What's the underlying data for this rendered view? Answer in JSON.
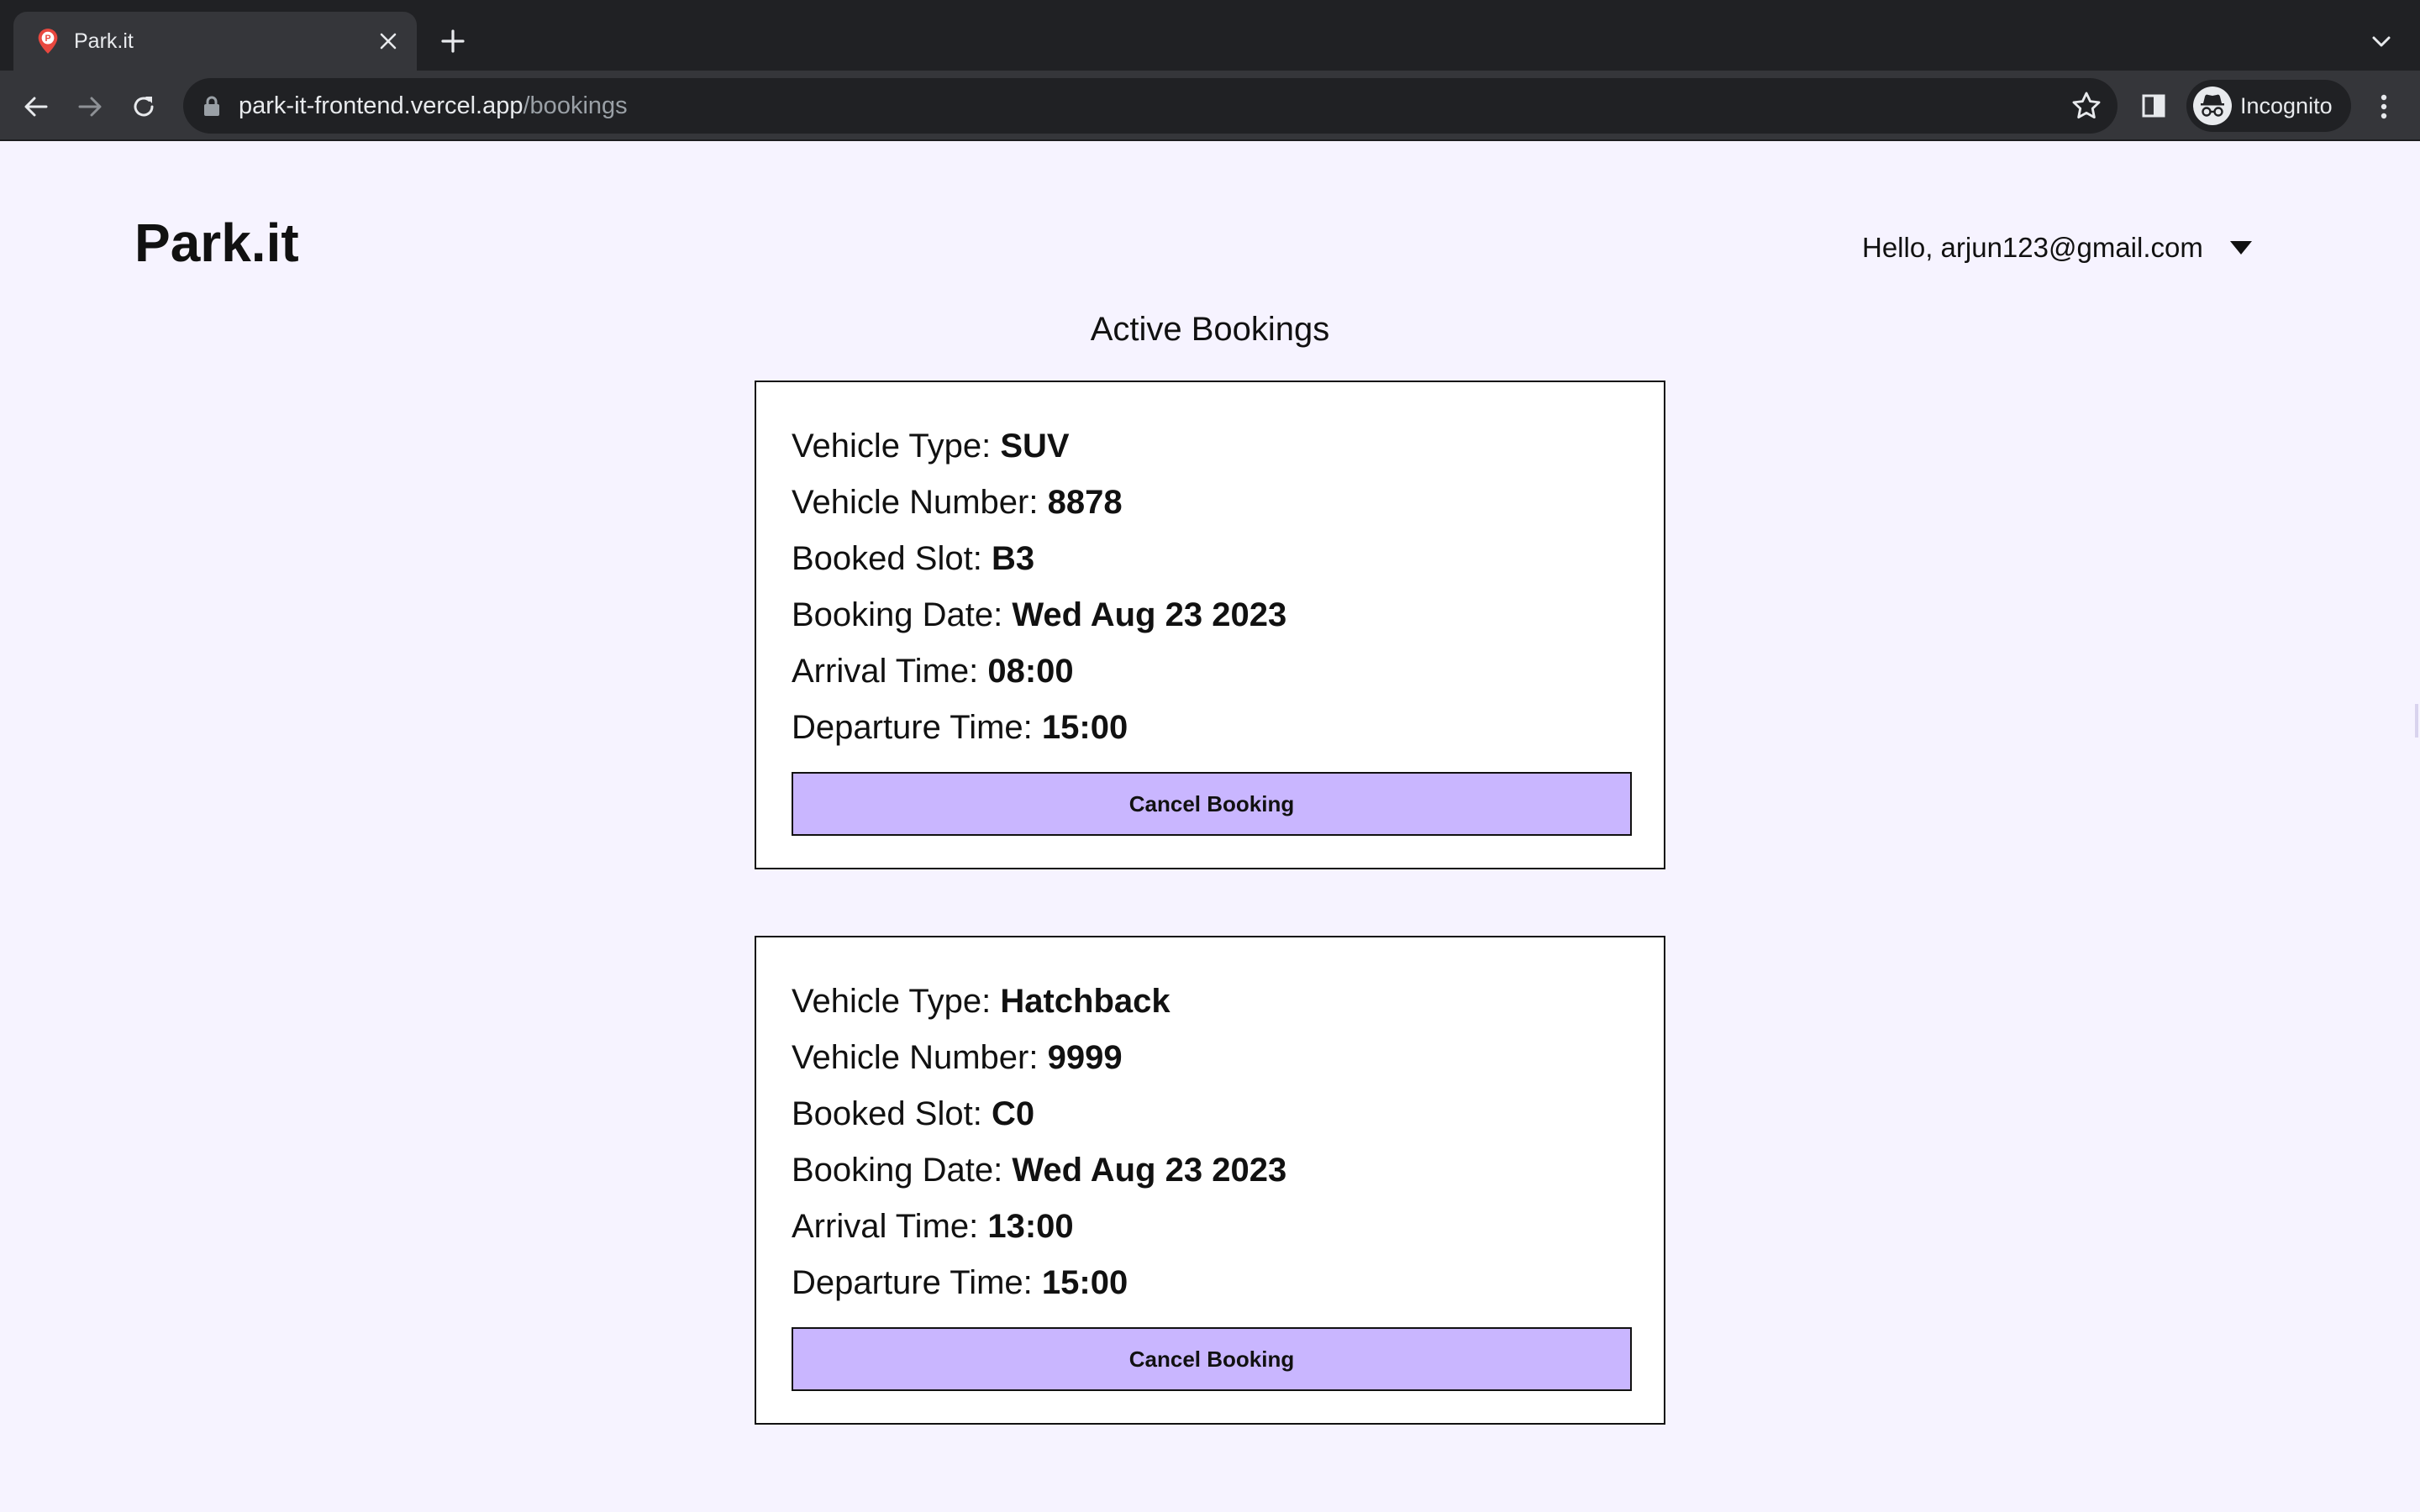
{
  "browser": {
    "tab_title": "Park.it",
    "url_host": "park-it-frontend.vercel.app",
    "url_path": "/bookings",
    "profile_label": "Incognito"
  },
  "icons": {
    "favicon": "park-it-pin-icon",
    "tab_close": "close-icon",
    "new_tab": "plus-icon",
    "tab_search": "chevron-down-icon",
    "back": "back-arrow-icon",
    "forward": "forward-arrow-icon",
    "reload": "reload-icon",
    "lock": "lock-icon",
    "bookmark": "star-icon",
    "side_panel": "side-panel-icon",
    "incognito": "incognito-icon",
    "menu": "kebab-menu-icon",
    "user_menu": "caret-down-icon"
  },
  "colors": {
    "page_background": "#f6f3ff",
    "button_fill": "#c9b6ff",
    "card_border": "#111111"
  },
  "header": {
    "brand": "Park.it",
    "user_greeting": "Hello, arjun123@gmail.com"
  },
  "main": {
    "title": "Active Bookings",
    "bookings": [
      {
        "vehicle_type_label": "Vehicle Type: ",
        "vehicle_type": "SUV",
        "vehicle_number_label": "Vehicle Number: ",
        "vehicle_number": "8878",
        "slot_label": "Booked Slot: ",
        "slot": "B3",
        "date_label": "Booking Date: ",
        "date": "Wed Aug 23 2023",
        "arrival_label": "Arrival Time: ",
        "arrival": "08:00",
        "departure_label": "Departure Time: ",
        "departure": "15:00",
        "cancel_label": "Cancel Booking"
      },
      {
        "vehicle_type_label": "Vehicle Type: ",
        "vehicle_type": "Hatchback",
        "vehicle_number_label": "Vehicle Number: ",
        "vehicle_number": "9999",
        "slot_label": "Booked Slot: ",
        "slot": "C0",
        "date_label": "Booking Date: ",
        "date": "Wed Aug 23 2023",
        "arrival_label": "Arrival Time: ",
        "arrival": "13:00",
        "departure_label": "Departure Time: ",
        "departure": "15:00",
        "cancel_label": "Cancel Booking"
      }
    ]
  }
}
